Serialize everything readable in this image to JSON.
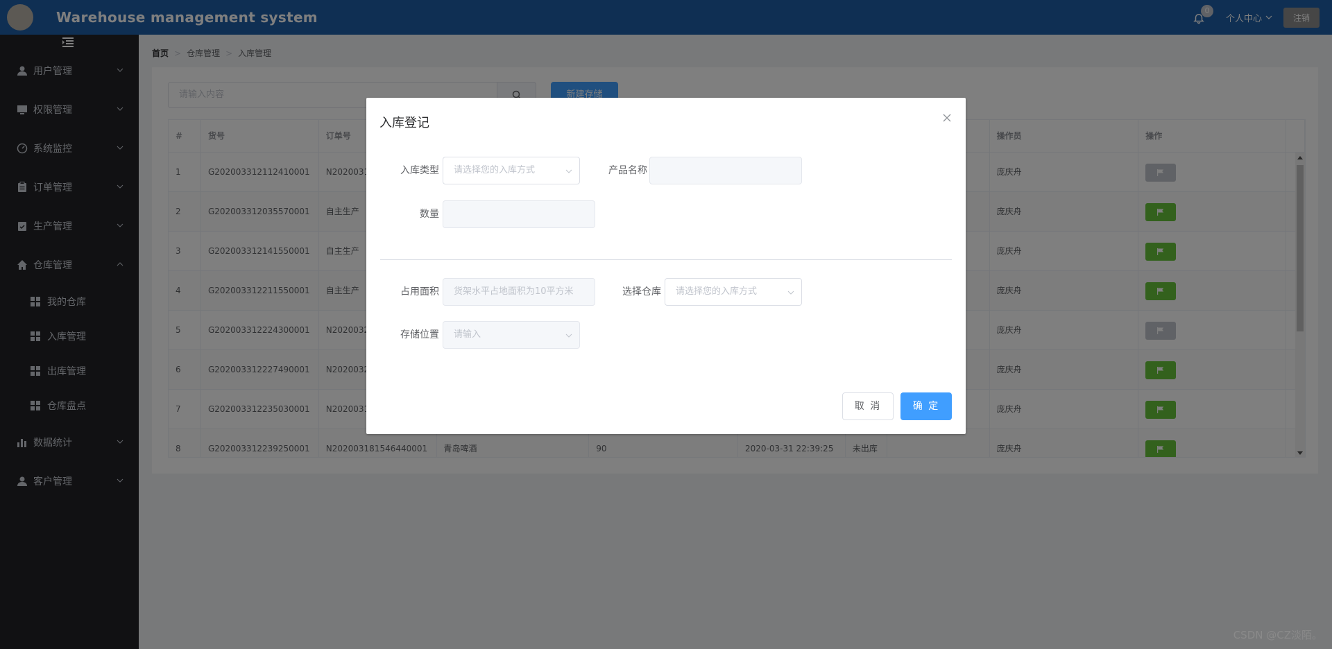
{
  "header": {
    "title": "Warehouse management system",
    "notification_count": "0",
    "user_center": "个人中心",
    "logout": "注销"
  },
  "sidebar": {
    "menu": [
      {
        "label": "用户管理",
        "icon": "user-icon"
      },
      {
        "label": "权限管理",
        "icon": "monitor-icon"
      },
      {
        "label": "系统监控",
        "icon": "gauge-icon"
      },
      {
        "label": "订单管理",
        "icon": "clipboard-icon"
      },
      {
        "label": "生产管理",
        "icon": "clipboard-check-icon"
      },
      {
        "label": "仓库管理",
        "icon": "home-icon"
      }
    ],
    "sub_items": [
      "我的仓库",
      "入库管理",
      "出库管理",
      "仓库盘点"
    ],
    "menu_after": [
      {
        "label": "数据统计",
        "icon": "bar-chart-icon"
      },
      {
        "label": "客户管理",
        "icon": "user-icon"
      }
    ]
  },
  "breadcrumb": {
    "home": "首页",
    "level1": "仓库管理",
    "level2": "入库管理"
  },
  "toolbar": {
    "search_placeholder": "请输入内容",
    "new_button": "新建存储"
  },
  "table": {
    "headers": [
      "#",
      "货号",
      "订单号",
      "",
      "",
      "",
      "",
      "",
      "操作员",
      "操作",
      ""
    ],
    "rows": [
      {
        "idx": "1",
        "goods_no": "G202003312112410001",
        "order_no": "N2020031",
        "product": "",
        "qty": "",
        "time": "",
        "status": "",
        "operator": "庞庆舟",
        "action": "gray"
      },
      {
        "idx": "2",
        "goods_no": "G202003312035570001",
        "order_no": "自主生产",
        "product": "",
        "qty": "",
        "time": "",
        "status": "",
        "operator": "庞庆舟",
        "action": "green"
      },
      {
        "idx": "3",
        "goods_no": "G202003312141550001",
        "order_no": "自主生产",
        "product": "",
        "qty": "",
        "time": "",
        "status": "",
        "operator": "庞庆舟",
        "action": "green"
      },
      {
        "idx": "4",
        "goods_no": "G202003312211550001",
        "order_no": "自主生产",
        "product": "",
        "qty": "",
        "time": "",
        "status": "",
        "operator": "庞庆舟",
        "action": "green"
      },
      {
        "idx": "5",
        "goods_no": "G202003312224300001",
        "order_no": "N2020032",
        "product": "",
        "qty": "",
        "time": "",
        "status": "",
        "operator": "庞庆舟",
        "action": "gray"
      },
      {
        "idx": "6",
        "goods_no": "G202003312227490001",
        "order_no": "N2020032",
        "product": "",
        "qty": "",
        "time": "",
        "status": "",
        "operator": "庞庆舟",
        "action": "green"
      },
      {
        "idx": "7",
        "goods_no": "G202003312235030001",
        "order_no": "N2020031",
        "product": "",
        "qty": "",
        "time": "",
        "status": "",
        "operator": "庞庆舟",
        "action": "green"
      },
      {
        "idx": "8",
        "goods_no": "G202003312239250001",
        "order_no": "N202003181546440001",
        "product": "青岛啤酒",
        "qty": "90",
        "time": "2020-03-31 22:39:25",
        "status": "未出库",
        "operator": "庞庆舟",
        "action": "green"
      }
    ]
  },
  "dialog": {
    "title": "入库登记",
    "fields": {
      "type_label": "入库类型",
      "type_placeholder": "请选择您的入库方式",
      "product_label": "产品名称",
      "product_value": "",
      "qty_label": "数量",
      "qty_value": "",
      "area_label": "占用面积",
      "area_placeholder": "货架水平占地面积为10平方米",
      "warehouse_label": "选择仓库",
      "warehouse_placeholder": "请选择您的入库方式",
      "location_label": "存储位置",
      "location_placeholder": "请输入"
    },
    "cancel": "取 消",
    "confirm": "确 定"
  },
  "watermark": "CSDN @CZ淡陌。",
  "colors": {
    "header_bg": "#1f5fa6",
    "sidebar_bg": "#222327",
    "primary": "#409eff",
    "success": "#67c23a"
  }
}
